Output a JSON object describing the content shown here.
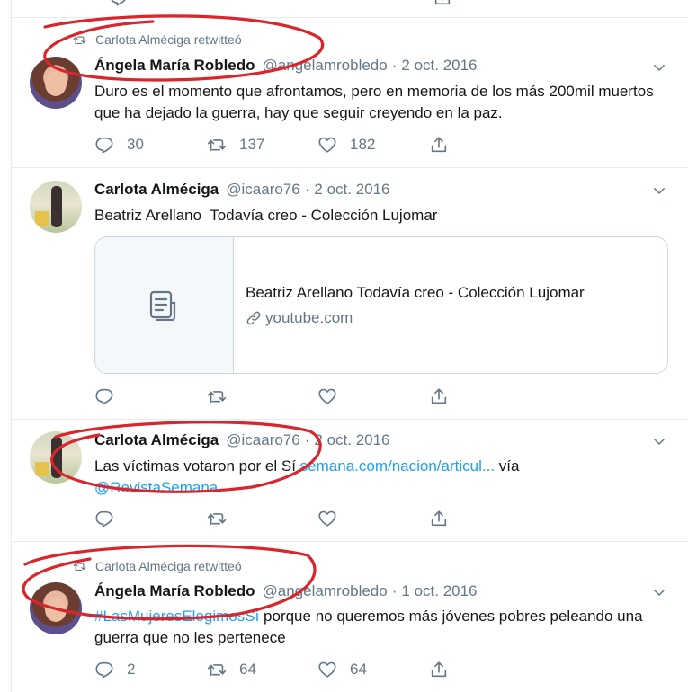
{
  "tweets": [
    {
      "retweeted_by": "Carlota Alméciga retwitteó",
      "name": "Ángela María Robledo",
      "handle": "@angelamrobledo",
      "sep": "·",
      "date": "2 oct. 2016",
      "text": "Duro es el momento que afrontamos, pero en memoria de los más 200mil muertos que ha dejado la guerra, hay que seguir creyendo en la paz.",
      "replies": "30",
      "retweets": "137",
      "likes": "182"
    },
    {
      "name": "Carlota Alméciga",
      "handle": "@icaaro76",
      "sep": "·",
      "date": "2 oct. 2016",
      "text": "Beatriz Arellano  Todavía creo - Colección Lujomar",
      "card": {
        "title": "Beatriz Arellano Todavía creo - Colección Lujomar",
        "url": "youtube.com"
      }
    },
    {
      "name": "Carlota Alméciga",
      "handle": "@icaaro76",
      "sep": "·",
      "date": "2 oct. 2016",
      "text_before": "Las víctimas votaron por el Sí",
      "link": "semana.com/nacion/articul...",
      "text_via": "vía",
      "mention": "@RevistaSemana"
    },
    {
      "retweeted_by": "Carlota Alméciga retwitteó",
      "name": "Ángela María Robledo",
      "handle": "@angelamrobledo",
      "sep": "·",
      "date": "1 oct. 2016",
      "hashtag": "#LasMujeresElegimosSí",
      "text_after": " porque no queremos más jóvenes pobres peleando una guerra que no les pertenece",
      "replies": "2",
      "retweets": "64",
      "likes": "64"
    }
  ],
  "colors": {
    "annotation_red": "#d9262c",
    "link_blue": "#1da1f2",
    "muted_gray": "#657786",
    "divider": "#e6ecf0"
  },
  "icons": [
    "retweet-icon",
    "reply-icon",
    "like-icon",
    "share-icon",
    "chevron-down-icon",
    "document-icon",
    "link-icon"
  ]
}
